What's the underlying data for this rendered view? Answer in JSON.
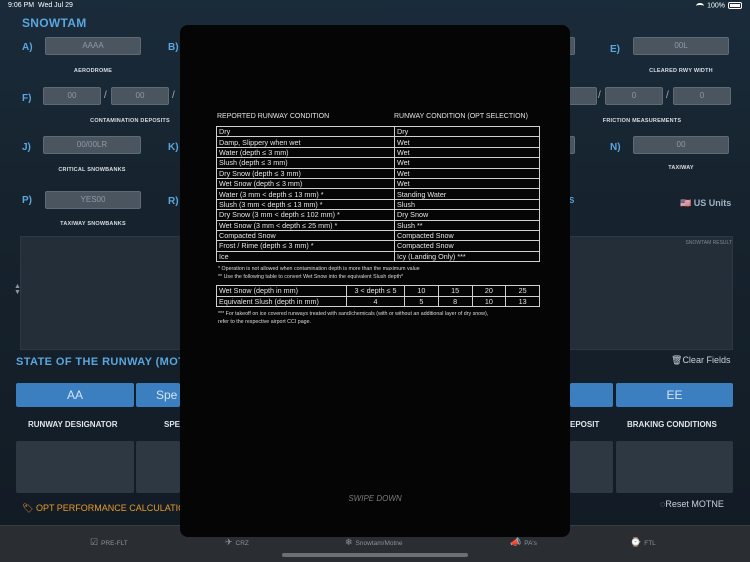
{
  "status": {
    "time": "9:06 PM",
    "date": "Wed Jul 29",
    "battery": "100%"
  },
  "header": {
    "title": "SNOWTAM"
  },
  "fields": {
    "A": {
      "letter": "A)",
      "value": "AAAA",
      "caption": "AERODROME"
    },
    "B": {
      "letter": "B)"
    },
    "E": {
      "letter": "E)",
      "value": "00L",
      "caption": "CLEARED RWY WIDTH"
    },
    "F": {
      "letter": "F)",
      "value1": "00",
      "value2": "00",
      "caption": "CONTAMINATION DEPOSITS"
    },
    "H": {
      "value1": "0",
      "value2": "0",
      "caption": "FRICTION MEASUREMENTS"
    },
    "J": {
      "letter": "J)",
      "value": "00/00LR",
      "caption": "CRITICAL SNOWBANKS"
    },
    "K": {
      "letter": "K)"
    },
    "N": {
      "letter": "N)",
      "value": "00",
      "caption": "TAXIWAY"
    },
    "P": {
      "letter": "P)",
      "value": "YES00",
      "caption": "TAXIWAY SNOWBANKS"
    },
    "R": {
      "letter": "R)"
    },
    "S": {
      "letter": "S"
    }
  },
  "units": {
    "label": "US Units",
    "flag": "🇺🇸"
  },
  "results": {
    "label": "SNOWTAM RESULT"
  },
  "actions": {
    "clear_fields": "Clear Fields",
    "reset_motne": "Reset MOTNE",
    "opt_performance": "OPT PERFORMANCE CALCULATIO"
  },
  "state": {
    "title": "STATE OF THE RUNWAY (MOTNE",
    "segments": {
      "aa": "AA",
      "spe": "Spe",
      "ee": "EE"
    },
    "columns": {
      "runway_designator": "RUNWAY DESIGNATOR",
      "spe": "SPE",
      "deposit": "EPOSIT",
      "braking": "BRAKING CONDITIONS"
    }
  },
  "tabs": [
    {
      "label": "PRE-FLT",
      "icon": "checkbox-icon"
    },
    {
      "label": "CRZ",
      "icon": "plane-icon"
    },
    {
      "label": "Snowtam/Motne",
      "icon": "snowflake-icon"
    },
    {
      "label": "PA's",
      "icon": "megaphone-icon"
    },
    {
      "label": "FTL",
      "icon": "clock-icon"
    }
  ],
  "modal": {
    "header_left": "REPORTED RUNWAY CONDITION",
    "header_right": "RUNWAY CONDITION (OPT SELECTION)",
    "rows": [
      {
        "reported": "Dry",
        "opt": "Dry"
      },
      {
        "reported": "Damp, Slippery when wet",
        "opt": "Wet"
      },
      {
        "reported": "Water (depth ≤ 3 mm)",
        "opt": "Wet"
      },
      {
        "reported": "Slush (depth ≤ 3 mm)",
        "opt": "Wet"
      },
      {
        "reported": "Dry Snow (depth ≤ 3 mm)",
        "opt": "Wet"
      },
      {
        "reported": "Wet Snow (depth ≤ 3 mm)",
        "opt": "Wet"
      },
      {
        "reported": "Water (3 mm < depth ≤ 13 mm) *",
        "opt": "Standing Water"
      },
      {
        "reported": "Slush (3 mm < depth ≤ 13 mm) *",
        "opt": "Slush"
      },
      {
        "reported": "Dry Snow (3 mm < depth ≤ 102 mm) *",
        "opt": "Dry Snow"
      },
      {
        "reported": "Wet Snow (3 mm < depth ≤ 25 mm) *",
        "opt": "Slush **"
      },
      {
        "reported": "Compacted Snow",
        "opt": "Compacted Snow"
      },
      {
        "reported": "Frost / Rime (depth ≤ 3 mm) *",
        "opt": "Compacted Snow"
      },
      {
        "reported": "Ice",
        "opt": "Icy (Landing Only) ***"
      }
    ],
    "note1": "* Operation is not allowed when contamination depth is more than the maximum value",
    "note2": "** Use the following table to convert Wet Snow into the equivalent Slush depth*",
    "slush_table": {
      "row1_label": "Wet Snow (depth in mm)",
      "row1": [
        "3 < depth ≤ 5",
        "10",
        "15",
        "20",
        "25"
      ],
      "row2_label": "Equivalent Slush (depth in mm)",
      "row2": [
        "4",
        "5",
        "8",
        "10",
        "13"
      ]
    },
    "note3": "*** For takeoff on ice covered runways treated with sand/chemicals (with or without an additional layer of dry snow),",
    "note4": "refer to the respective airport CCI page.",
    "swipe": "SWIPE DOWN"
  }
}
